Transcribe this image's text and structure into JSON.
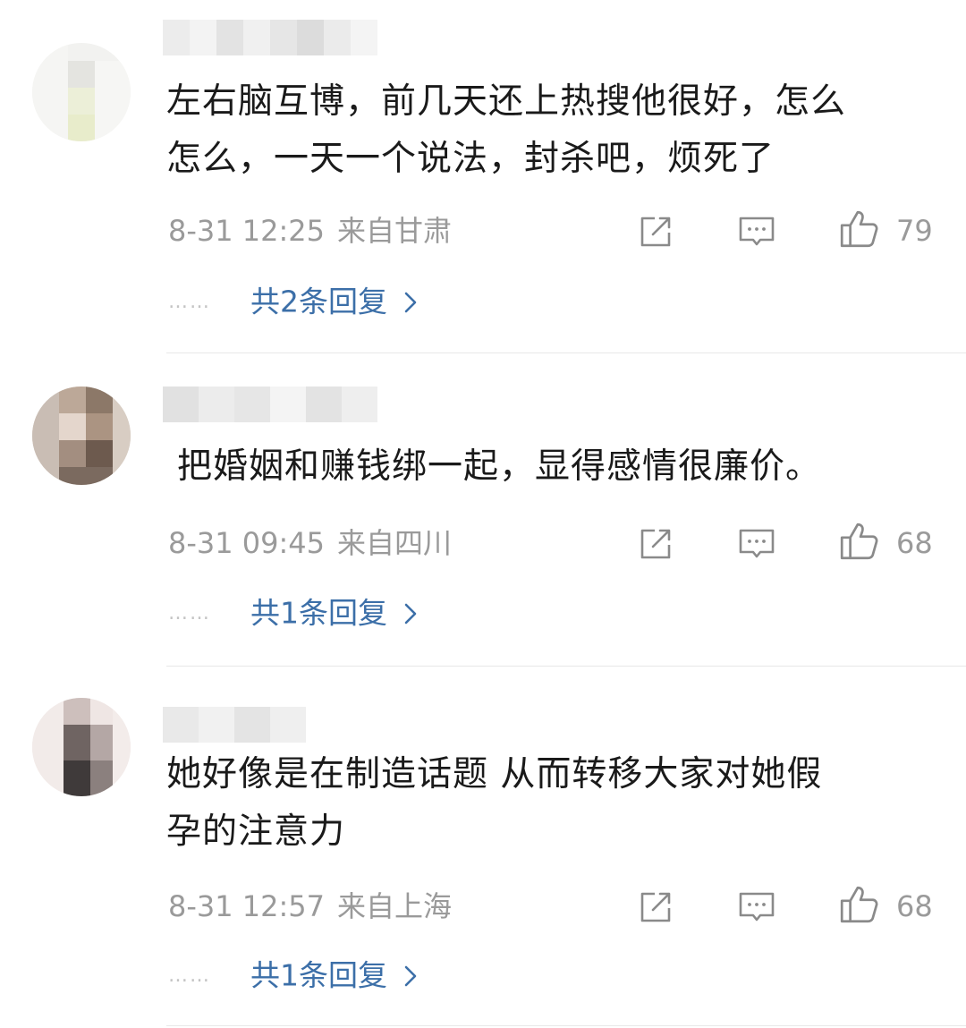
{
  "comments": [
    {
      "text": "左右脑互博，前几天还上热搜他很好，怎么\n怎么，一天一个说法，封杀吧，烦死了",
      "time": "8-31 12:25",
      "location": "来自甘肃",
      "likes": "79",
      "replies": "共2条回复",
      "dots": "……"
    },
    {
      "text": "把婚姻和赚钱绑一起，显得感情很廉价。",
      "time": "8-31 09:45",
      "location": "来自四川",
      "likes": "68",
      "replies": "共1条回复",
      "dots": "……"
    },
    {
      "text": "她好像是在制造话题 从而转移大家对她假\n孕的注意力",
      "time": "8-31 12:57",
      "location": "来自上海",
      "likes": "68",
      "replies": "共1条回复",
      "dots": "……"
    }
  ],
  "icons": {
    "share": "share-icon",
    "comment": "comment-icon",
    "like": "thumbs-up-icon",
    "chevron": "chevron-right-icon"
  },
  "colors": {
    "text": "#1a1a1a",
    "meta": "#9a9a9a",
    "link": "#3c6fa8",
    "icon": "#8a8a8a",
    "divider": "#e8e8e8"
  }
}
